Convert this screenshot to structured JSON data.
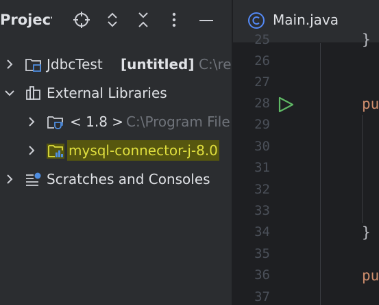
{
  "project_panel": {
    "title": "Project",
    "toolbar": [
      {
        "icon": "locate-icon"
      },
      {
        "icon": "expand-all-icon"
      },
      {
        "icon": "collapse-all-icon"
      },
      {
        "icon": "more-options-icon"
      },
      {
        "icon": "hide-icon"
      }
    ],
    "tree": [
      {
        "label": "JdbcTest",
        "badge": "[untitled]",
        "path": "C:\\re",
        "expanded": false,
        "icon": "module-folder-icon"
      },
      {
        "label": "External Libraries",
        "expanded": true,
        "icon": "libraries-icon"
      },
      {
        "label": "< 1.8 >",
        "path": "C:\\Program File",
        "expanded": false,
        "icon": "jdk-icon"
      },
      {
        "label": "mysql-connector-j-8.0",
        "expanded": false,
        "icon": "library-jar-icon",
        "highlighted": true
      },
      {
        "label": "Scratches and Consoles",
        "expanded": false,
        "icon": "scratches-icon"
      }
    ]
  },
  "editor": {
    "tab": {
      "label": "Main.java",
      "icon": "java-class-icon"
    },
    "line_numbers": [
      "25",
      "26",
      "27",
      "28",
      "29",
      "30",
      "31",
      "32",
      "33",
      "34",
      "35",
      "36",
      "37"
    ],
    "code": {
      "line28": "pu",
      "line34": "}",
      "line36": "pu",
      "line25": "}"
    }
  },
  "colors": {
    "panel_bg": "#2b2d30",
    "editor_bg": "#1e1f22",
    "highlight_bg": "#56560f",
    "highlight_fg": "#e0df3e",
    "keyword": "#cf8e6d",
    "run_green": "#5fb865"
  }
}
